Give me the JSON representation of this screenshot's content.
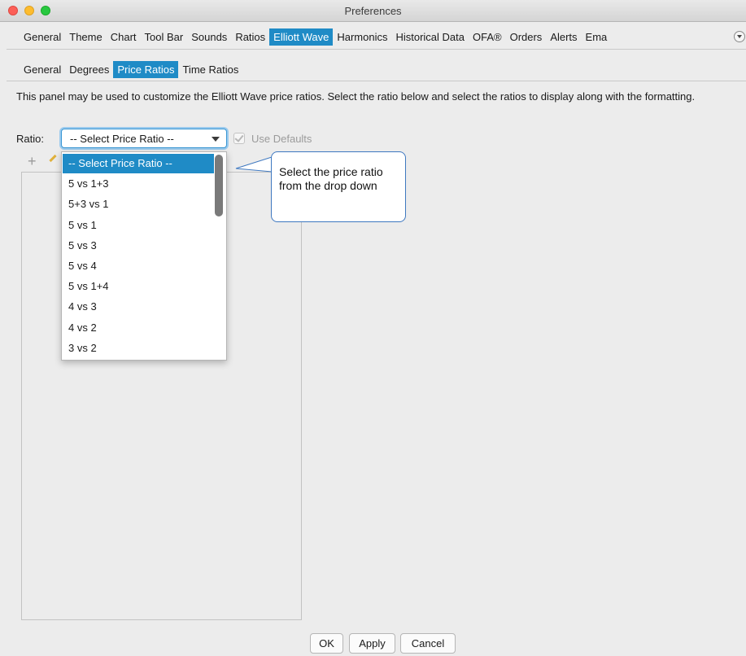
{
  "window": {
    "title": "Preferences"
  },
  "top_tabs": [
    "General",
    "Theme",
    "Chart",
    "Tool Bar",
    "Sounds",
    "Ratios",
    "Elliott Wave",
    "Harmonics",
    "Historical Data",
    "OFA®",
    "Orders",
    "Alerts",
    "Ema"
  ],
  "top_active": "Elliott Wave",
  "sub_tabs": [
    "General",
    "Degrees",
    "Price Ratios",
    "Time Ratios"
  ],
  "sub_active": "Price Ratios",
  "description": "This panel may be used to customize the Elliott Wave price ratios.  Select the ratio below and select the ratios to display along with the formatting.",
  "ratio": {
    "label": "Ratio:",
    "selected": "-- Select Price Ratio --"
  },
  "use_defaults": {
    "label": "Use Defaults",
    "checked": true,
    "enabled": false
  },
  "dropdown_options": [
    "-- Select Price Ratio --",
    "5 vs 1+3",
    "5+3 vs 1",
    "5 vs 1",
    "5 vs 3",
    "5 vs 4",
    "5 vs 1+4",
    "4 vs 3",
    "4 vs 2",
    "3 vs 2"
  ],
  "callout": {
    "text": "Select the price ratio from the drop down"
  },
  "buttons": {
    "ok": "OK",
    "apply": "Apply",
    "cancel": "Cancel"
  },
  "colors": {
    "accent": "#1f8bc6",
    "callout_border": "#3e78c0"
  }
}
